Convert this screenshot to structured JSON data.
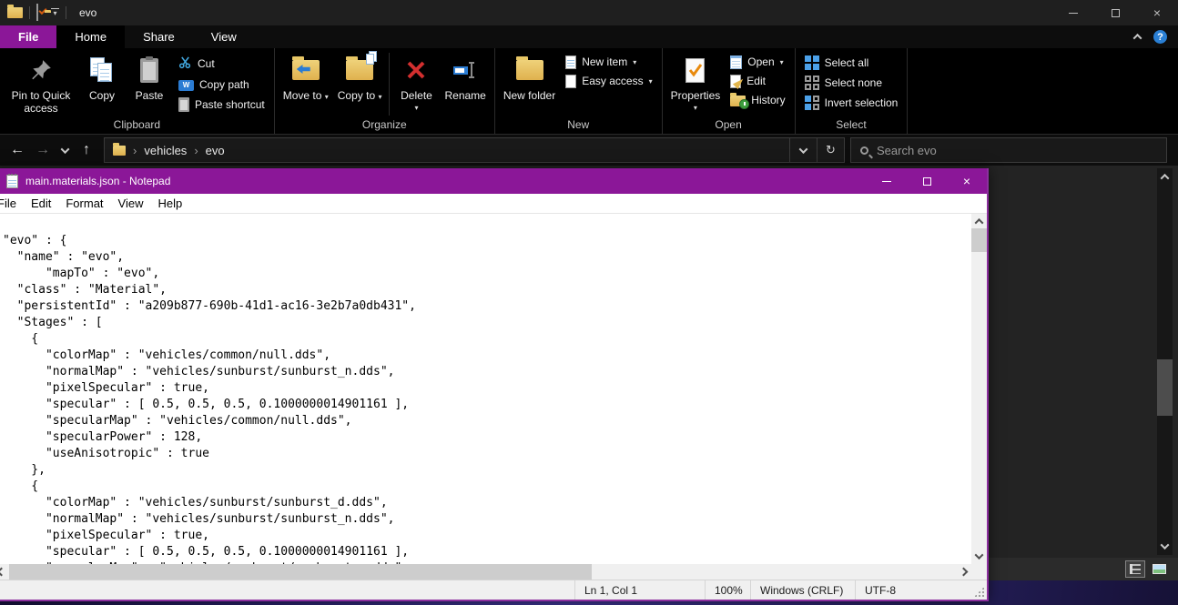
{
  "explorer": {
    "title": "evo",
    "tabs": {
      "file": "File",
      "home": "Home",
      "share": "Share",
      "view": "View"
    },
    "ribbon": {
      "clipboard": {
        "label": "Clipboard",
        "pin_to_quick_access": "Pin to Quick access",
        "copy": "Copy",
        "paste": "Paste",
        "cut": "Cut",
        "copy_path": "Copy path",
        "paste_shortcut": "Paste shortcut"
      },
      "organize": {
        "label": "Organize",
        "move_to": "Move to",
        "copy_to": "Copy to",
        "delete": "Delete",
        "rename": "Rename"
      },
      "new_group": {
        "label": "New",
        "new_folder": "New folder",
        "new_item": "New item",
        "easy_access": "Easy access"
      },
      "open_group": {
        "label": "Open",
        "properties": "Properties",
        "open": "Open",
        "edit": "Edit",
        "history": "History"
      },
      "select_group": {
        "label": "Select",
        "select_all": "Select all",
        "select_none": "Select none",
        "invert_selection": "Invert selection"
      }
    },
    "address": {
      "crumbs": [
        "vehicles",
        "evo"
      ],
      "search_placeholder": "Search evo"
    }
  },
  "notepad": {
    "title": "main.materials.json - Notepad",
    "menu": {
      "file": "File",
      "edit": "Edit",
      "format": "Format",
      "view": "View",
      "help": "Help"
    },
    "content": "\n\"evo\" : {\n  \"name\" : \"evo\",\n      \"mapTo\" : \"evo\",\n  \"class\" : \"Material\",\n  \"persistentId\" : \"a209b877-690b-41d1-ac16-3e2b7a0db431\",\n  \"Stages\" : [\n    {\n      \"colorMap\" : \"vehicles/common/null.dds\",\n      \"normalMap\" : \"vehicles/sunburst/sunburst_n.dds\",\n      \"pixelSpecular\" : true,\n      \"specular\" : [ 0.5, 0.5, 0.5, 0.1000000014901161 ],\n      \"specularMap\" : \"vehicles/common/null.dds\",\n      \"specularPower\" : 128,\n      \"useAnisotropic\" : true\n    },\n    {\n      \"colorMap\" : \"vehicles/sunburst/sunburst_d.dds\",\n      \"normalMap\" : \"vehicles/sunburst/sunburst_n.dds\",\n      \"pixelSpecular\" : true,\n      \"specular\" : [ 0.5, 0.5, 0.5, 0.1000000014901161 ],\n      \"specularMap\" : \"vehicles/sunburst/sunburst_s.dds\",",
    "status": {
      "cursor": "Ln 1, Col 1",
      "zoom": "100%",
      "eol": "Windows (CRLF)",
      "encoding": "UTF-8"
    }
  },
  "icons": {
    "back": "←",
    "forward": "→",
    "up": "↑",
    "dropdown": "▾",
    "refresh": "↻",
    "crumb_sep": "›",
    "close": "×",
    "help": "?",
    "w_glyph": "W"
  },
  "colors": {
    "accent_purple": "#8b1798",
    "ribbon_bg": "#000000",
    "explorer_content_bg": "#232323",
    "delete_red": "#d32f2f",
    "select_blue": "#4ba0e8"
  }
}
